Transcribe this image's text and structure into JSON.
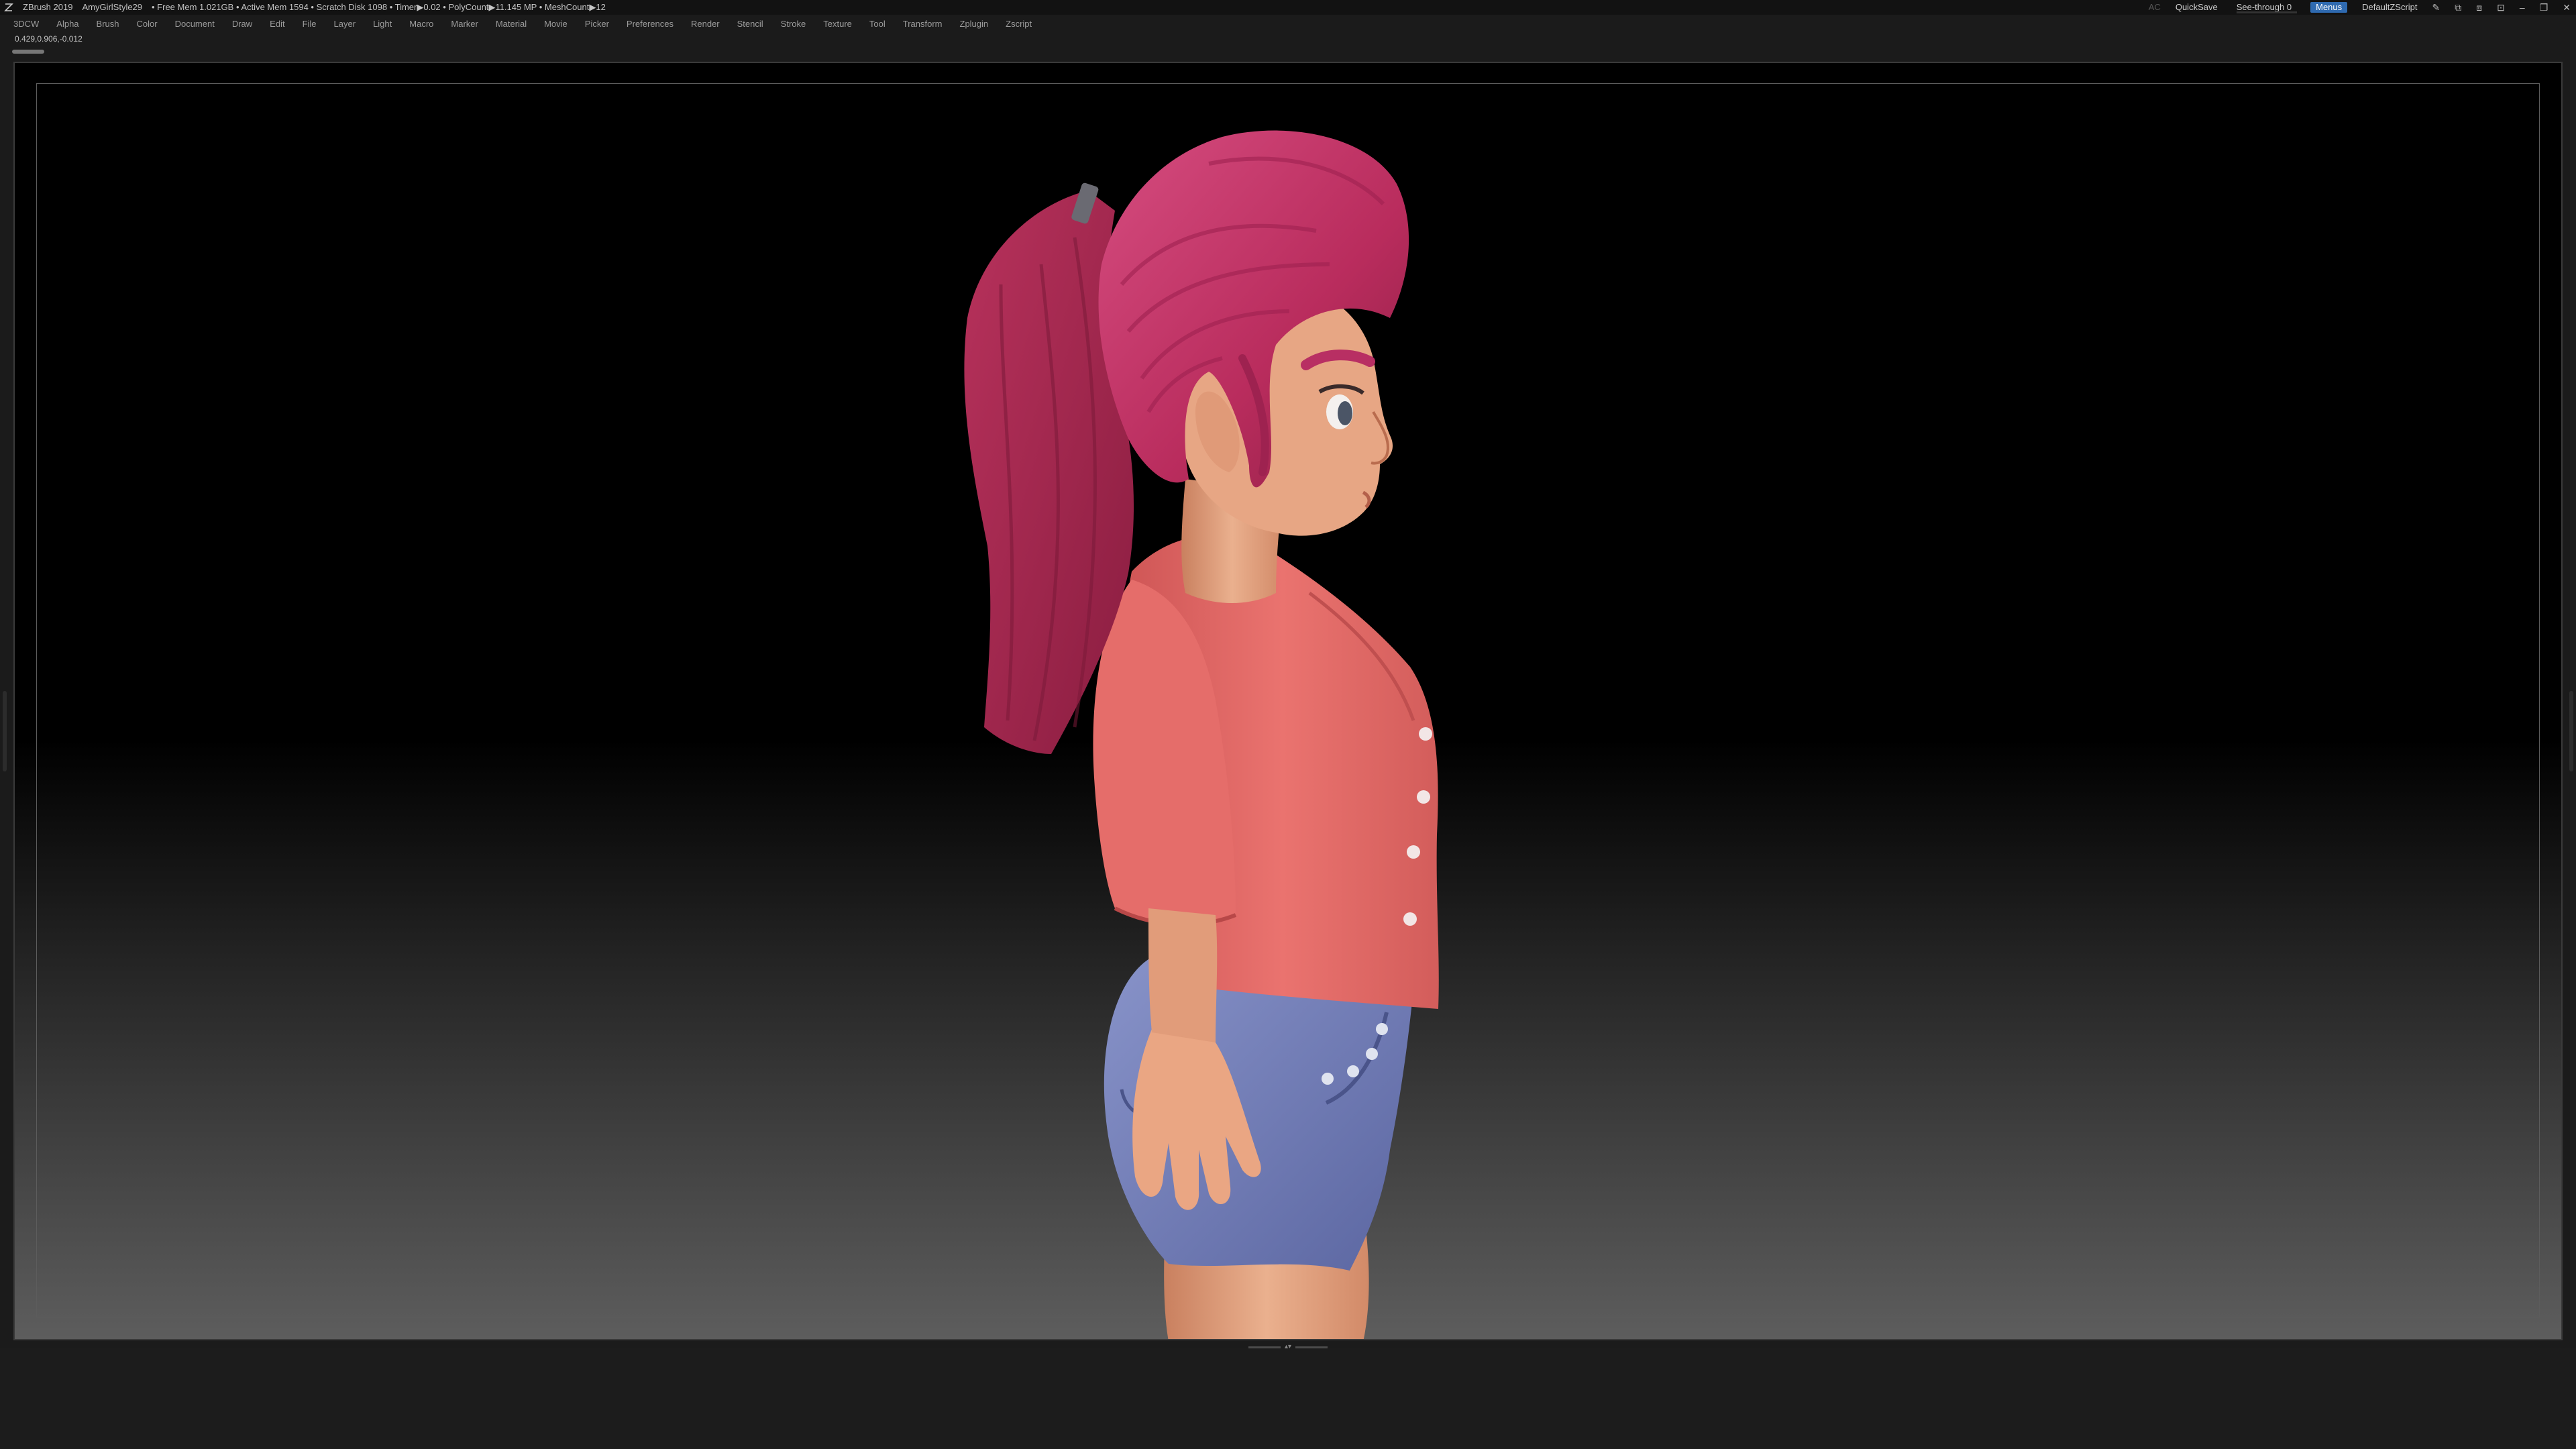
{
  "titlebar": {
    "app_name": "ZBrush 2019",
    "document": "AmyGirlStyle29",
    "stats": "• Free Mem 1.021GB • Active Mem 1594 • Scratch Disk 1098 • Timer▶0.02 • PolyCount▶11.145 MP • MeshCount▶12",
    "ac_label": "AC",
    "quicksave": "QuickSave",
    "see_through": "See-through 0",
    "see_through_value": 0,
    "menus": "Menus",
    "script": "DefaultZScript",
    "icons": [
      "brush-icon",
      "layout-icon",
      "layout2-icon",
      "lock-icon",
      "minimize-icon",
      "restore-icon",
      "close-icon"
    ]
  },
  "menubar": {
    "items": [
      "3DCW",
      "Alpha",
      "Brush",
      "Color",
      "Document",
      "Draw",
      "Edit",
      "File",
      "Layer",
      "Light",
      "Macro",
      "Marker",
      "Material",
      "Movie",
      "Picker",
      "Preferences",
      "Render",
      "Stencil",
      "Stroke",
      "Texture",
      "Tool",
      "Transform",
      "Zplugin",
      "Zscript"
    ]
  },
  "coords": "0.429,0.906,-0.012",
  "colors": {
    "accent": "#2f6ab0",
    "hair": "#c53a6c",
    "skin": "#e3a07c",
    "shirt": "#e36a66",
    "shorts": "#7480b8"
  }
}
